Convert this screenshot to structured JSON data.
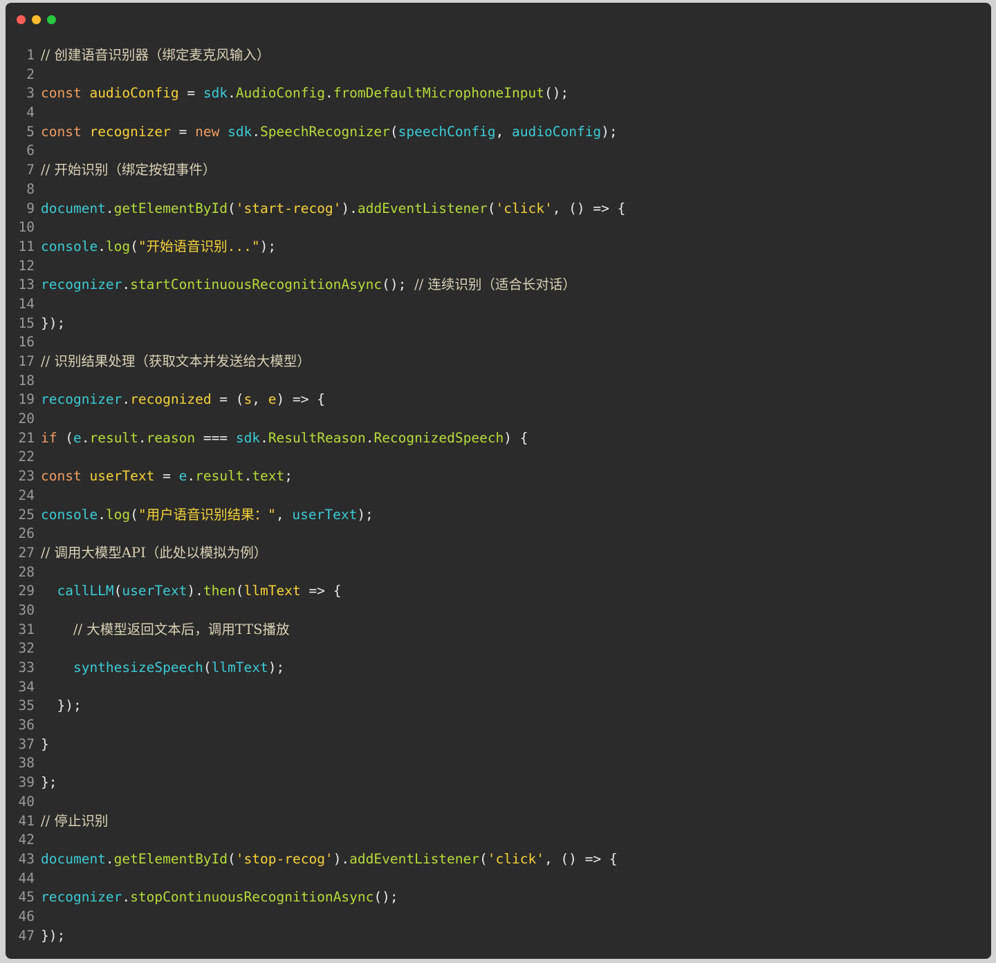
{
  "window": {
    "controls": [
      {
        "name": "close",
        "color": "#ff5f57"
      },
      {
        "name": "minimize",
        "color": "#febc2e"
      },
      {
        "name": "zoom",
        "color": "#28c840"
      }
    ]
  },
  "code": {
    "language": "javascript",
    "colors": {
      "background": "#2b2b2b",
      "keyword": "#f29d63",
      "variable": "#f5d23a",
      "reference": "#3ccbd4",
      "function": "#b7db3a",
      "string": "#f5d23a",
      "comment": "#d7d2b6"
    },
    "lines": [
      {
        "n": "1",
        "indent": 0,
        "tokens": [
          {
            "t": "// 创建语音识别器（绑定麦克风输入）",
            "c": "cm"
          }
        ]
      },
      {
        "n": "2",
        "indent": 0,
        "tokens": []
      },
      {
        "n": "3",
        "indent": 0,
        "tokens": [
          {
            "t": "const",
            "c": "kw"
          },
          {
            "t": " ",
            "c": "op"
          },
          {
            "t": "audioConfig",
            "c": "var"
          },
          {
            "t": " = ",
            "c": "op"
          },
          {
            "t": "sdk",
            "c": "ref"
          },
          {
            "t": ".",
            "c": "punc"
          },
          {
            "t": "AudioConfig",
            "c": "fn"
          },
          {
            "t": ".",
            "c": "punc"
          },
          {
            "t": "fromDefaultMicrophoneInput",
            "c": "fn"
          },
          {
            "t": "();",
            "c": "punc"
          }
        ]
      },
      {
        "n": "4",
        "indent": 0,
        "tokens": []
      },
      {
        "n": "5",
        "indent": 0,
        "tokens": [
          {
            "t": "const",
            "c": "kw"
          },
          {
            "t": " ",
            "c": "op"
          },
          {
            "t": "recognizer",
            "c": "var"
          },
          {
            "t": " = ",
            "c": "op"
          },
          {
            "t": "new",
            "c": "kw"
          },
          {
            "t": " ",
            "c": "op"
          },
          {
            "t": "sdk",
            "c": "ref"
          },
          {
            "t": ".",
            "c": "punc"
          },
          {
            "t": "SpeechRecognizer",
            "c": "fn"
          },
          {
            "t": "(",
            "c": "punc"
          },
          {
            "t": "speechConfig",
            "c": "ref"
          },
          {
            "t": ", ",
            "c": "punc"
          },
          {
            "t": "audioConfig",
            "c": "ref"
          },
          {
            "t": ");",
            "c": "punc"
          }
        ]
      },
      {
        "n": "6",
        "indent": 0,
        "tokens": []
      },
      {
        "n": "7",
        "indent": 0,
        "tokens": [
          {
            "t": "// 开始识别（绑定按钮事件）",
            "c": "cm"
          }
        ]
      },
      {
        "n": "8",
        "indent": 0,
        "tokens": []
      },
      {
        "n": "9",
        "indent": 0,
        "tokens": [
          {
            "t": "document",
            "c": "ref"
          },
          {
            "t": ".",
            "c": "punc"
          },
          {
            "t": "getElementById",
            "c": "fn"
          },
          {
            "t": "(",
            "c": "punc"
          },
          {
            "t": "'start-recog'",
            "c": "str"
          },
          {
            "t": ").",
            "c": "punc"
          },
          {
            "t": "addEventListener",
            "c": "fn"
          },
          {
            "t": "(",
            "c": "punc"
          },
          {
            "t": "'click'",
            "c": "str"
          },
          {
            "t": ", () => {",
            "c": "punc"
          }
        ]
      },
      {
        "n": "10",
        "indent": 0,
        "tokens": []
      },
      {
        "n": "11",
        "indent": 0,
        "tokens": [
          {
            "t": "console",
            "c": "ref"
          },
          {
            "t": ".",
            "c": "punc"
          },
          {
            "t": "log",
            "c": "fn"
          },
          {
            "t": "(",
            "c": "punc"
          },
          {
            "t": "\"开始语音识别...\"",
            "c": "str"
          },
          {
            "t": ");",
            "c": "punc"
          }
        ]
      },
      {
        "n": "12",
        "indent": 0,
        "tokens": []
      },
      {
        "n": "13",
        "indent": 0,
        "tokens": [
          {
            "t": "recognizer",
            "c": "ref"
          },
          {
            "t": ".",
            "c": "punc"
          },
          {
            "t": "startContinuousRecognitionAsync",
            "c": "fn"
          },
          {
            "t": "(); ",
            "c": "punc"
          },
          {
            "t": "// 连续识别（适合长对话）",
            "c": "cm"
          }
        ]
      },
      {
        "n": "14",
        "indent": 0,
        "tokens": []
      },
      {
        "n": "15",
        "indent": 0,
        "tokens": [
          {
            "t": "});",
            "c": "punc"
          }
        ]
      },
      {
        "n": "16",
        "indent": 0,
        "tokens": []
      },
      {
        "n": "17",
        "indent": 0,
        "tokens": [
          {
            "t": "// 识别结果处理（获取文本并发送给大模型）",
            "c": "cm"
          }
        ]
      },
      {
        "n": "18",
        "indent": 0,
        "tokens": []
      },
      {
        "n": "19",
        "indent": 0,
        "tokens": [
          {
            "t": "recognizer",
            "c": "ref"
          },
          {
            "t": ".",
            "c": "punc"
          },
          {
            "t": "recognized",
            "c": "var"
          },
          {
            "t": " = (",
            "c": "op"
          },
          {
            "t": "s",
            "c": "var"
          },
          {
            "t": ", ",
            "c": "punc"
          },
          {
            "t": "e",
            "c": "var"
          },
          {
            "t": ") => {",
            "c": "punc"
          }
        ]
      },
      {
        "n": "20",
        "indent": 0,
        "tokens": []
      },
      {
        "n": "21",
        "indent": 0,
        "tokens": [
          {
            "t": "if",
            "c": "kw"
          },
          {
            "t": " (",
            "c": "punc"
          },
          {
            "t": "e",
            "c": "ref"
          },
          {
            "t": ".",
            "c": "punc"
          },
          {
            "t": "result",
            "c": "fn"
          },
          {
            "t": ".",
            "c": "punc"
          },
          {
            "t": "reason",
            "c": "fn"
          },
          {
            "t": " === ",
            "c": "op"
          },
          {
            "t": "sdk",
            "c": "ref"
          },
          {
            "t": ".",
            "c": "punc"
          },
          {
            "t": "ResultReason",
            "c": "fn"
          },
          {
            "t": ".",
            "c": "punc"
          },
          {
            "t": "RecognizedSpeech",
            "c": "fn"
          },
          {
            "t": ") {",
            "c": "punc"
          }
        ]
      },
      {
        "n": "22",
        "indent": 0,
        "tokens": []
      },
      {
        "n": "23",
        "indent": 0,
        "tokens": [
          {
            "t": "const",
            "c": "kw"
          },
          {
            "t": " ",
            "c": "op"
          },
          {
            "t": "userText",
            "c": "var"
          },
          {
            "t": " = ",
            "c": "op"
          },
          {
            "t": "e",
            "c": "ref"
          },
          {
            "t": ".",
            "c": "punc"
          },
          {
            "t": "result",
            "c": "fn"
          },
          {
            "t": ".",
            "c": "punc"
          },
          {
            "t": "text",
            "c": "fn"
          },
          {
            "t": ";",
            "c": "punc"
          }
        ]
      },
      {
        "n": "24",
        "indent": 0,
        "tokens": []
      },
      {
        "n": "25",
        "indent": 0,
        "tokens": [
          {
            "t": "console",
            "c": "ref"
          },
          {
            "t": ".",
            "c": "punc"
          },
          {
            "t": "log",
            "c": "fn"
          },
          {
            "t": "(",
            "c": "punc"
          },
          {
            "t": "\"用户语音识别结果：\"",
            "c": "str"
          },
          {
            "t": ", ",
            "c": "punc"
          },
          {
            "t": "userText",
            "c": "ref"
          },
          {
            "t": ");",
            "c": "punc"
          }
        ]
      },
      {
        "n": "26",
        "indent": 0,
        "tokens": []
      },
      {
        "n": "27",
        "indent": 0,
        "tokens": [
          {
            "t": "// 调用大模型API（此处以模拟为例）",
            "c": "cm"
          }
        ]
      },
      {
        "n": "28",
        "indent": 0,
        "tokens": []
      },
      {
        "n": "29",
        "indent": 2,
        "tokens": [
          {
            "t": "callLLM",
            "c": "ref"
          },
          {
            "t": "(",
            "c": "punc"
          },
          {
            "t": "userText",
            "c": "ref"
          },
          {
            "t": ").",
            "c": "punc"
          },
          {
            "t": "then",
            "c": "fn"
          },
          {
            "t": "(",
            "c": "punc"
          },
          {
            "t": "llmText",
            "c": "var"
          },
          {
            "t": " => {",
            "c": "punc"
          }
        ]
      },
      {
        "n": "30",
        "indent": 0,
        "tokens": []
      },
      {
        "n": "31",
        "indent": 4,
        "tokens": [
          {
            "t": "// 大模型返回文本后，调用TTS播放",
            "c": "cm"
          }
        ]
      },
      {
        "n": "32",
        "indent": 0,
        "tokens": []
      },
      {
        "n": "33",
        "indent": 4,
        "tokens": [
          {
            "t": "synthesizeSpeech",
            "c": "ref"
          },
          {
            "t": "(",
            "c": "punc"
          },
          {
            "t": "llmText",
            "c": "ref"
          },
          {
            "t": ");",
            "c": "punc"
          }
        ]
      },
      {
        "n": "34",
        "indent": 0,
        "tokens": []
      },
      {
        "n": "35",
        "indent": 2,
        "tokens": [
          {
            "t": "});",
            "c": "punc"
          }
        ]
      },
      {
        "n": "36",
        "indent": 0,
        "tokens": []
      },
      {
        "n": "37",
        "indent": 0,
        "tokens": [
          {
            "t": "}",
            "c": "punc"
          }
        ]
      },
      {
        "n": "38",
        "indent": 0,
        "tokens": []
      },
      {
        "n": "39",
        "indent": 0,
        "tokens": [
          {
            "t": "};",
            "c": "punc"
          }
        ]
      },
      {
        "n": "40",
        "indent": 0,
        "tokens": []
      },
      {
        "n": "41",
        "indent": 0,
        "tokens": [
          {
            "t": "// 停止识别",
            "c": "cm"
          }
        ]
      },
      {
        "n": "42",
        "indent": 0,
        "tokens": []
      },
      {
        "n": "43",
        "indent": 0,
        "tokens": [
          {
            "t": "document",
            "c": "ref"
          },
          {
            "t": ".",
            "c": "punc"
          },
          {
            "t": "getElementById",
            "c": "fn"
          },
          {
            "t": "(",
            "c": "punc"
          },
          {
            "t": "'stop-recog'",
            "c": "str"
          },
          {
            "t": ").",
            "c": "punc"
          },
          {
            "t": "addEventListener",
            "c": "fn"
          },
          {
            "t": "(",
            "c": "punc"
          },
          {
            "t": "'click'",
            "c": "str"
          },
          {
            "t": ", () => {",
            "c": "punc"
          }
        ]
      },
      {
        "n": "44",
        "indent": 0,
        "tokens": []
      },
      {
        "n": "45",
        "indent": 0,
        "tokens": [
          {
            "t": "recognizer",
            "c": "ref"
          },
          {
            "t": ".",
            "c": "punc"
          },
          {
            "t": "stopContinuousRecognitionAsync",
            "c": "fn"
          },
          {
            "t": "();",
            "c": "punc"
          }
        ]
      },
      {
        "n": "46",
        "indent": 0,
        "tokens": []
      },
      {
        "n": "47",
        "indent": 0,
        "tokens": [
          {
            "t": "});",
            "c": "punc"
          }
        ]
      }
    ]
  }
}
